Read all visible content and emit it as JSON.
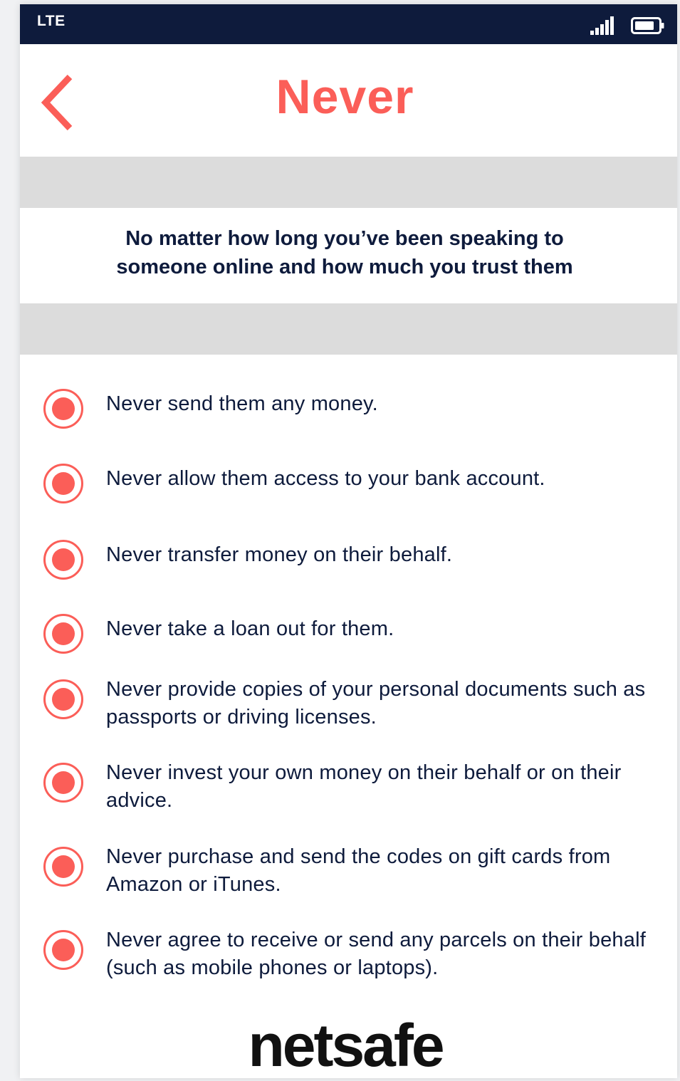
{
  "status_bar": {
    "carrier": "LTE",
    "signal_icon": "signal-bars-icon",
    "battery_icon": "battery-icon"
  },
  "header": {
    "back_icon": "chevron-left-icon",
    "title": "Never"
  },
  "intro": {
    "text": "No matter how long you’ve been speaking to someone online and how much you trust them"
  },
  "items": [
    {
      "text": "Never send them any money."
    },
    {
      "text": "Never allow them access to your bank account."
    },
    {
      "text": "Never transfer money on their behalf."
    },
    {
      "text": "Never take a loan out for them."
    },
    {
      "text": "Never provide copies of your personal documents such as passports or driving licenses."
    },
    {
      "text": "Never invest your own money on their behalf or on their advice."
    },
    {
      "text": "Never purchase and send the codes on gift cards from Amazon or iTunes."
    },
    {
      "text": "Never agree to receive or send any parcels on their behalf (such as mobile phones or laptops)."
    }
  ],
  "footer": {
    "logo_text": "netsafe"
  },
  "colors": {
    "accent": "#fb5e58",
    "navy": "#0e1b3c",
    "band": "#dcdcdc"
  }
}
